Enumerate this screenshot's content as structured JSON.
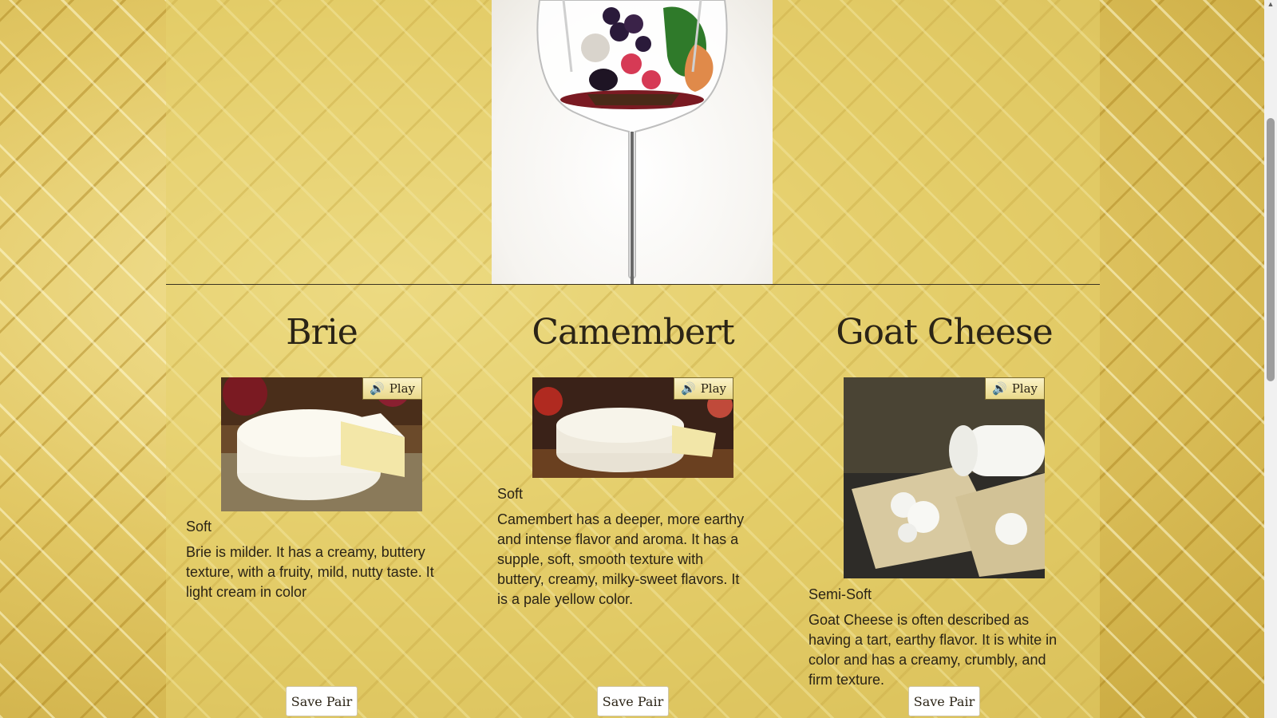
{
  "hero": {
    "image": "wine-glass-with-fruits"
  },
  "cheeses": [
    {
      "name": "Brie",
      "play_label": "Play",
      "type": "Soft",
      "description": "Brie is milder. It has a creamy, buttery texture, with a fruity, mild, nutty taste. It light cream in color",
      "save_label": "Save Pair",
      "photo": "brie-photo"
    },
    {
      "name": "Camembert",
      "play_label": "Play",
      "type": "Soft",
      "description": "Camembert has a deeper, more earthy and intense flavor and aroma. It has a supple, soft, smooth texture with buttery, creamy, milky-sweet flavors. It is a pale yellow color.",
      "save_label": "Save Pair",
      "photo": "camembert-photo"
    },
    {
      "name": "Goat Cheese",
      "play_label": "Play",
      "type": "Semi-Soft",
      "description": "Goat Cheese is often described as having a tart, earthy flavor. It is white in color and has a creamy, crumbly, and firm texture.",
      "save_label": "Save Pair",
      "photo": "goat-cheese-photo"
    }
  ],
  "colors": {
    "background": "#d9c05a",
    "text": "#2b2416",
    "button_bg": "#ffffff"
  }
}
